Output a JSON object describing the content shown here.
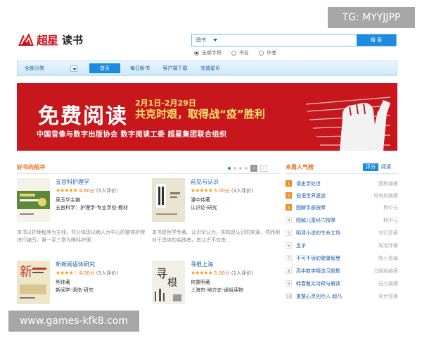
{
  "watermarks": {
    "top": "TG: MYYJJPP",
    "bottom": "www.games-kfk8.com"
  },
  "header": {
    "logo_text": "超星",
    "logo_sub": "读书",
    "search": {
      "category": "图书",
      "placeholder": "",
      "button": "搜 索"
    },
    "radios": [
      {
        "label": "全部字段",
        "checked": true
      },
      {
        "label": "书名",
        "checked": false
      },
      {
        "label": "作者",
        "checked": false
      }
    ]
  },
  "nav": {
    "all_label": "全部分类",
    "items": [
      {
        "label": "首页",
        "active": true
      },
      {
        "label": "每日新书",
        "active": false
      },
      {
        "label": "客户端下载",
        "active": false
      },
      {
        "label": "充值星币",
        "active": false
      }
    ]
  },
  "banner": {
    "title": "免费阅读",
    "date": "2月1日-2月29日",
    "slogan": "共克时艰，取得战“疫”胜利",
    "org": "中国音像与数字出版协会  数字阅读工委  超星集团联合组织"
  },
  "left_section": {
    "title": "好书向前冲",
    "books": [
      {
        "title": "五官科护理学",
        "stars": "★★★★★",
        "score": "4.60分",
        "count": "(5人评价)",
        "author": "吴玉华主编",
        "category": "五官科学：护理学-专业学校-教材",
        "desc": "本书以护理程序为主线，充分体现以病人为中心的整体护理进行编写。第一至三章为眼科护理…",
        "cover_color": "#5d8a3a"
      },
      {
        "title": "前见与认识",
        "stars": "★★★★★",
        "score": "5.00分",
        "count": "(3人评价)",
        "author": "潘中伟著",
        "category": "认识论-研究",
        "desc": "本书是哲学专著。认识论认为，实践是认识的来源，然而相对于具体的实践者，其认识不仅由…",
        "cover_color": "#e9e4d2"
      },
      {
        "title": "新新闻语体研究",
        "stars": "★★★★☆",
        "score": "4.00分",
        "count": "(3人评价)",
        "author": "熊玮著",
        "category": "新闻学-语体-研究",
        "desc": "",
        "cover_color": "#efe7c9"
      },
      {
        "title": "寻根上海",
        "stars": "★★★★★",
        "score": "5.00分",
        "count": "(1人评价)",
        "author": "何重明著",
        "category": "上海市-地方史-通俗读物",
        "desc": "",
        "cover_color": "#f2efe6"
      }
    ]
  },
  "right_section": {
    "title": "本周人气榜",
    "tabs": [
      {
        "label": "评分",
        "active": true
      },
      {
        "label": "阅读",
        "active": false
      }
    ],
    "ranks": [
      {
        "num": "1",
        "title": "读史学处世",
        "author": "图秋编著"
      },
      {
        "num": "2",
        "title": "低语世界遗迹",
        "author": "司有和编著"
      },
      {
        "num": "3",
        "title": "图解手部按摩",
        "author": "杨中元"
      },
      {
        "num": "4",
        "title": "图解儿童经穴按摩",
        "author": "杨中元"
      },
      {
        "num": "5",
        "title": "明清小说的生命立场",
        "author": "刘衍青著"
      },
      {
        "num": "6",
        "title": "孟子",
        "author": "周淑萍著"
      },
      {
        "num": "7",
        "title": "不可不读的健康智慧",
        "author": "陈小青编"
      },
      {
        "num": "8",
        "title": "高中数学精选习题集",
        "author": "冯朝岩编著"
      },
      {
        "num": "9",
        "title": "韩春散文诗释与解读",
        "author": "石九编著"
      },
      {
        "num": "10",
        "title": "重整心灵创巨人 超凡",
        "author": "吴世雪著"
      }
    ]
  },
  "colors": {
    "accent": "#1d8ce0",
    "banner": "#c8161d",
    "orange": "#e56c1b"
  }
}
